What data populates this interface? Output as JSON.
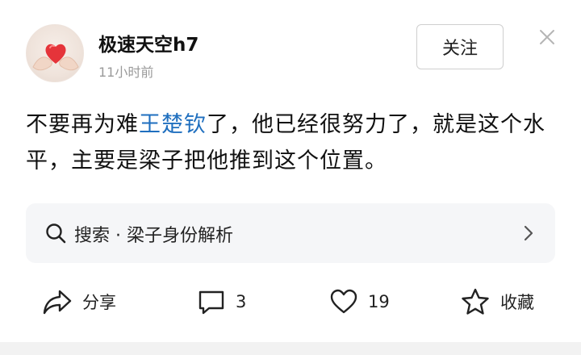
{
  "post": {
    "author": {
      "name": "极速天空h7",
      "time": "11小时前"
    },
    "follow_label": "关注",
    "body": {
      "before_mention": "不要再为难",
      "mention": "王楚钦",
      "after_mention": "了，他已经很努力了，就是这个水平，主要是梁子把他推到这个位置。"
    },
    "search": {
      "text": "搜索 · 梁子身份解析"
    },
    "actions": {
      "share": "分享",
      "comments": "3",
      "likes": "19",
      "favorite": "收藏"
    }
  },
  "colors": {
    "mention": "#1f6fbf",
    "muted": "#9a9a9a",
    "search_bg": "#f5f6f8"
  },
  "icons": [
    "heart-hands-avatar",
    "close-icon",
    "search-icon",
    "chevron-right-icon",
    "share-icon",
    "comment-icon",
    "heart-icon",
    "star-icon"
  ]
}
